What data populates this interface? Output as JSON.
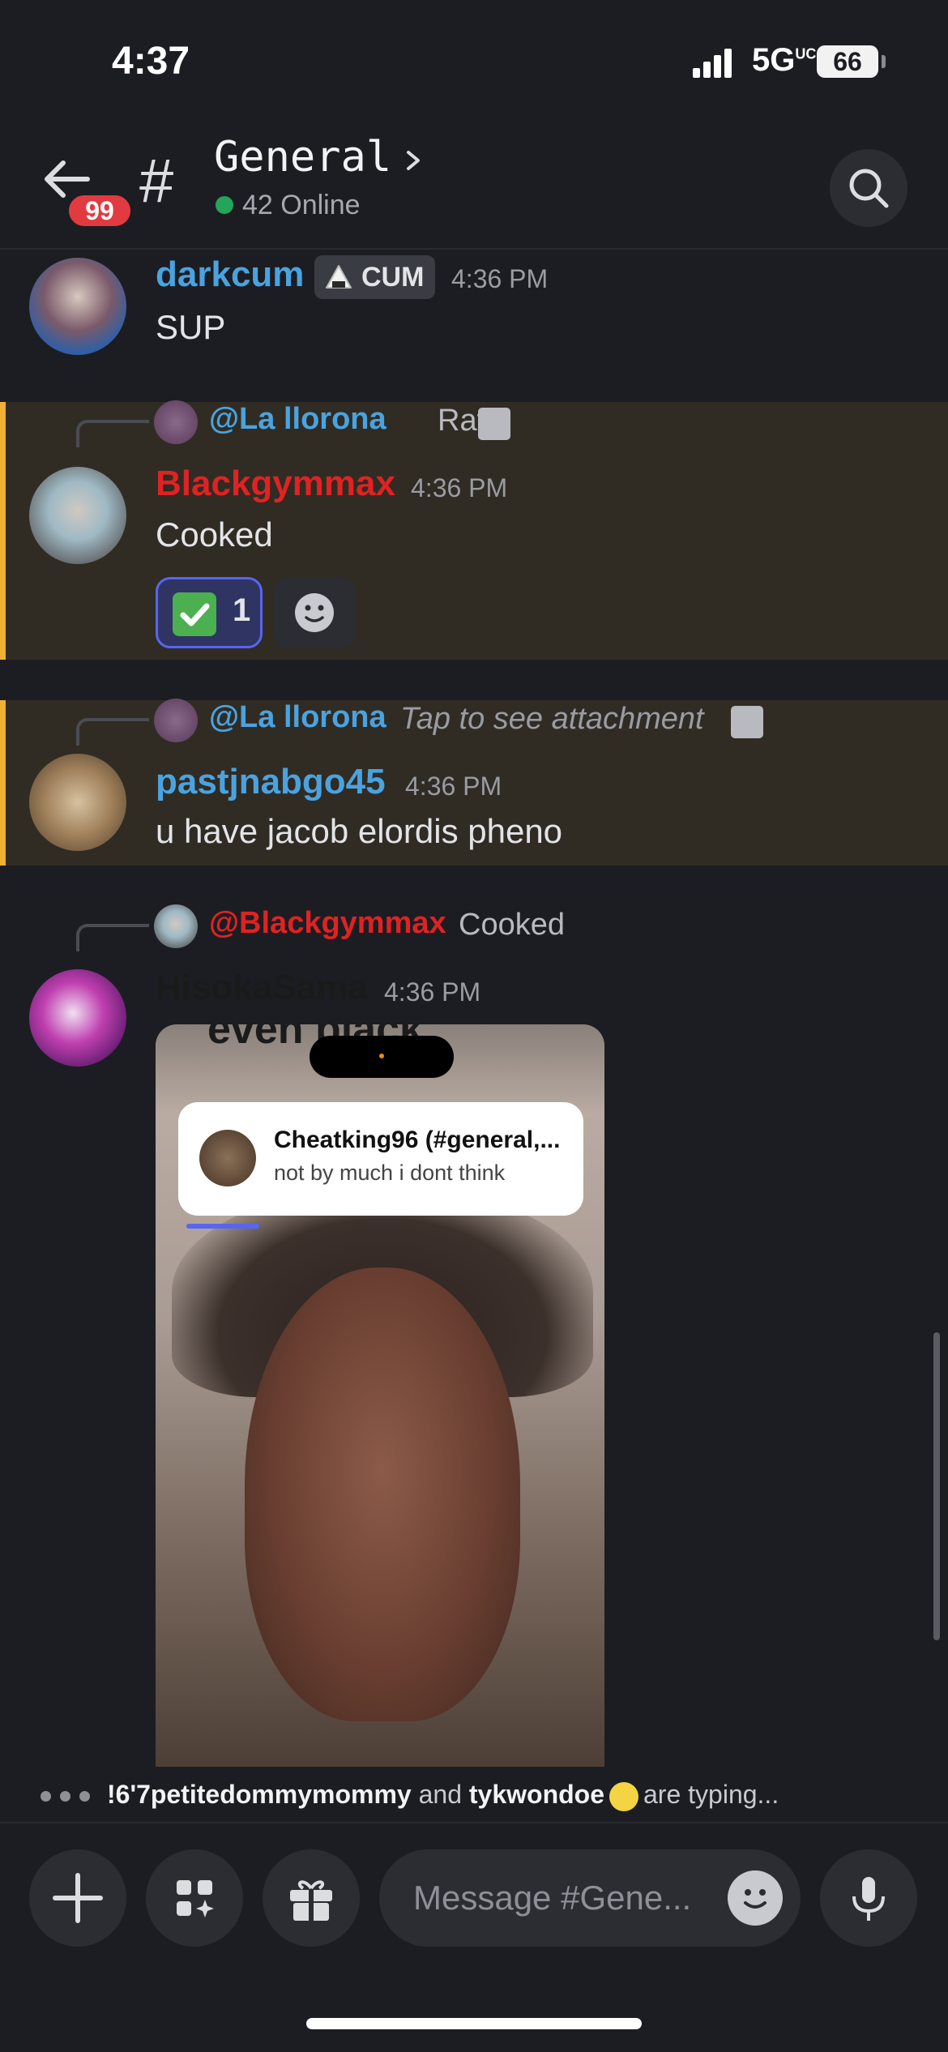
{
  "status_bar": {
    "time": "4:37",
    "network": "5G",
    "network_sup": "UC",
    "battery": "66"
  },
  "header": {
    "unread_badge": "99",
    "hash_symbol": "#",
    "channel_name": "General",
    "online_text": "42 Online"
  },
  "messages": [
    {
      "username": "darkcum",
      "role_tag": "CUM",
      "timestamp": "4:36 PM",
      "text": "SUP",
      "username_color": "#4aa3e0"
    },
    {
      "reply_mention": "@La llorona",
      "reply_text": "Rate",
      "username": "Blackgymmax",
      "timestamp": "4:36 PM",
      "text": "Cooked",
      "reaction_count": "1",
      "username_color": "#e02222"
    },
    {
      "reply_mention": "@La llorona",
      "reply_text": "Tap to see attachment",
      "username": "pastjnabgo45",
      "timestamp": "4:36 PM",
      "text": "u have jacob elordis pheno",
      "username_color": "#4aa3e0"
    },
    {
      "reply_mention": "@Blackgymmax",
      "reply_text": "Cooked",
      "username": "HisokaSama",
      "timestamp": "4:36 PM",
      "username_color": "#1a1a1a",
      "embed": {
        "top_text": "even black",
        "notification_title": "Cheatking96 (#general,...",
        "notification_body": "not by much i dont think"
      }
    }
  ],
  "typing": {
    "user1": "!6'7petitedommymommy",
    "and": "and",
    "user2": "tykwondoe",
    "suffix": "are typing..."
  },
  "composer": {
    "placeholder": "Message #Gene..."
  },
  "colors": {
    "background": "#1c1d22",
    "highlight": "#302c24",
    "highlight_border": "#f0b232",
    "blurple": "#5865f2"
  }
}
